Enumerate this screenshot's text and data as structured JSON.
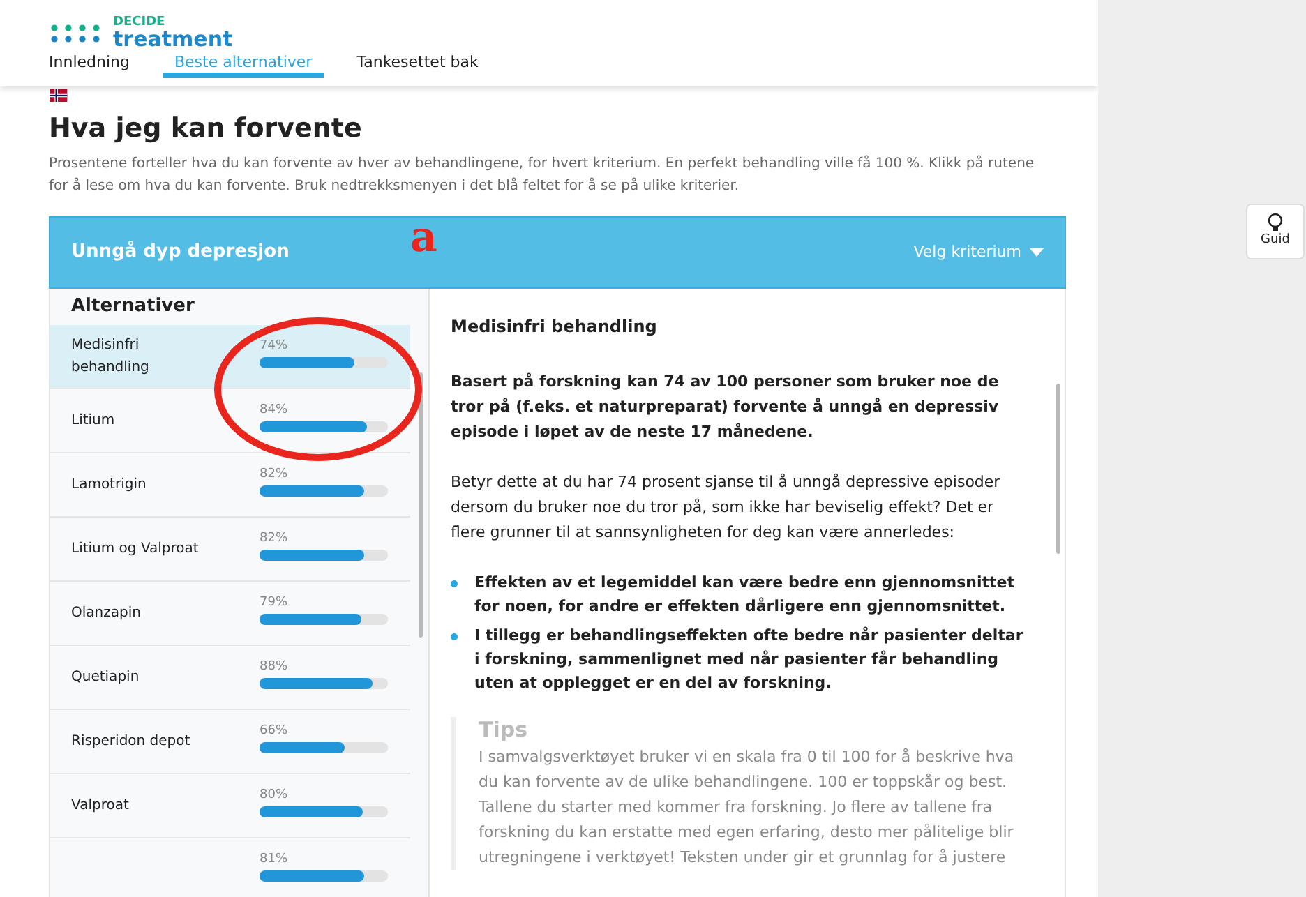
{
  "logo": {
    "line1": "DECIDE",
    "line2": "treatment"
  },
  "nav": [
    {
      "label": "Innledning",
      "selected": false
    },
    {
      "label": "Beste alternativer",
      "selected": true
    },
    {
      "label": "Tankesettet bak",
      "selected": false
    }
  ],
  "heading": "Hva jeg kan forvente",
  "intro": "Prosentene forteller hva du kan forvente av hver av behandlingene, for hvert kriterium. En perfekt behandling ville få 100 %. Klikk på rutene for å lese om hva du kan forvente. Bruk nedtrekksmenyen i det blå feltet for å se på ulike kriterier.",
  "criterion_bar": {
    "title": "Unngå dyp depresjon",
    "dropdown": "Velg kriterium"
  },
  "annotation": "a",
  "alternatives": {
    "heading": "Alternativer",
    "items": [
      {
        "name": "Medisinfri behandling",
        "percent": "74%",
        "level": 0.74,
        "selected": true
      },
      {
        "name": "Litium",
        "percent": "84%",
        "level": 0.84,
        "selected": false
      },
      {
        "name": "Lamotrigin",
        "percent": "82%",
        "level": 0.82,
        "selected": false
      },
      {
        "name": "Litium og Valproat",
        "percent": "82%",
        "level": 0.82,
        "selected": false
      },
      {
        "name": "Olanzapin",
        "percent": "79%",
        "level": 0.79,
        "selected": false
      },
      {
        "name": "Quetiapin",
        "percent": "88%",
        "level": 0.88,
        "selected": false
      },
      {
        "name": "Risperidon depot",
        "percent": "66%",
        "level": 0.66,
        "selected": false
      },
      {
        "name": "Valproat",
        "percent": "80%",
        "level": 0.8,
        "selected": false
      },
      {
        "percent": "81%",
        "level": 0.81,
        "selected": false
      }
    ]
  },
  "detail": {
    "title": "Medisinfri behandling",
    "lead": "Basert på forskning kan 74 av 100 personer som bruker noe de tror på (f.eks. et naturpreparat) forvente å unngå en depressiv episode i løpet av de neste 17 månedene.",
    "body": "Betyr dette at du har 74 prosent sjanse til å unngå depressive episoder dersom du bruker noe du tror på, som ikke har beviselig effekt? Det er flere grunner til at sannsynligheten for deg kan være annerledes:",
    "bullets": [
      "Effekten av et legemiddel kan være bedre enn gjennomsnittet for noen, for andre er effekten dårligere enn gjennomsnittet.",
      "I tillegg er behandlingseffekten ofte bedre når pasienter deltar i forskning, sammenlignet med når pasienter får behandling uten at opplegget er en del av forskning."
    ],
    "tips": {
      "title": "Tips",
      "text": "I samvalgsverktøyet bruker vi en skala fra 0 til 100 for å beskrive hva du kan forvente av de ulike behandlingene. 100 er toppskår og best. Tallene du starter med kommer fra forskning. Jo flere av tallene fra forskning du kan erstatte med egen erfaring, desto mer pålitelige blir utregningene i verktøyet! Teksten under gir et grunnlag for å justere"
    }
  },
  "guide_button": "Guid"
}
